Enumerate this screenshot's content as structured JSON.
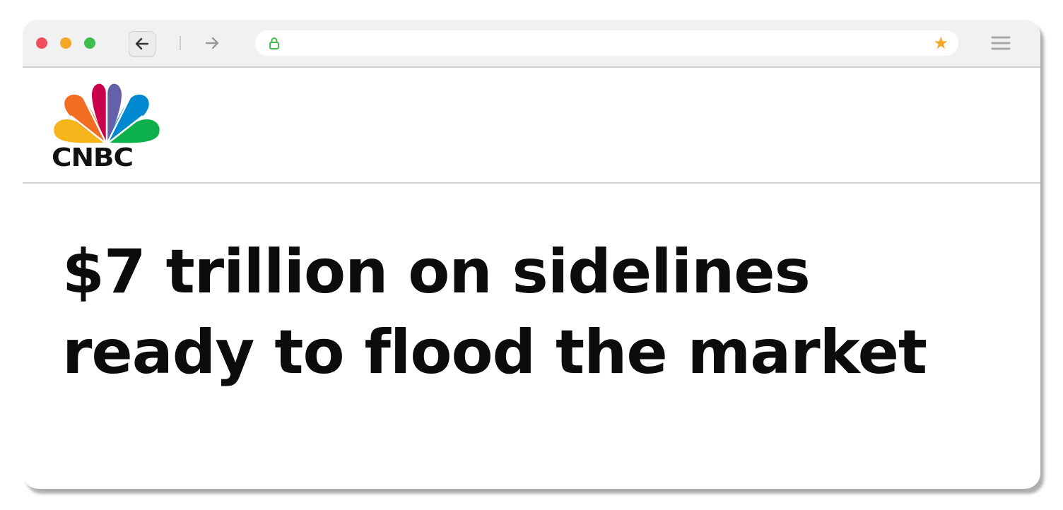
{
  "browser": {
    "controls": {
      "back_icon": "arrow-left-icon",
      "forward_icon": "arrow-right-icon",
      "lock_icon": "lock-icon",
      "bookmark_icon": "star-icon",
      "menu_icon": "hamburger-menu-icon"
    },
    "colors": {
      "close": "#ee4e5e",
      "minimize": "#f5a623",
      "maximize": "#3fbd4a",
      "lock": "#3fbd4a",
      "star": "#f5a623"
    }
  },
  "site": {
    "logo_text": "CNBC",
    "logo_colors": [
      "#f7b51c",
      "#f26d21",
      "#c9004b",
      "#6460aa",
      "#0089d0",
      "#0db14b"
    ]
  },
  "article": {
    "headline_line1": "$7 trillion on sidelines",
    "headline_line2": "ready to flood the market"
  }
}
